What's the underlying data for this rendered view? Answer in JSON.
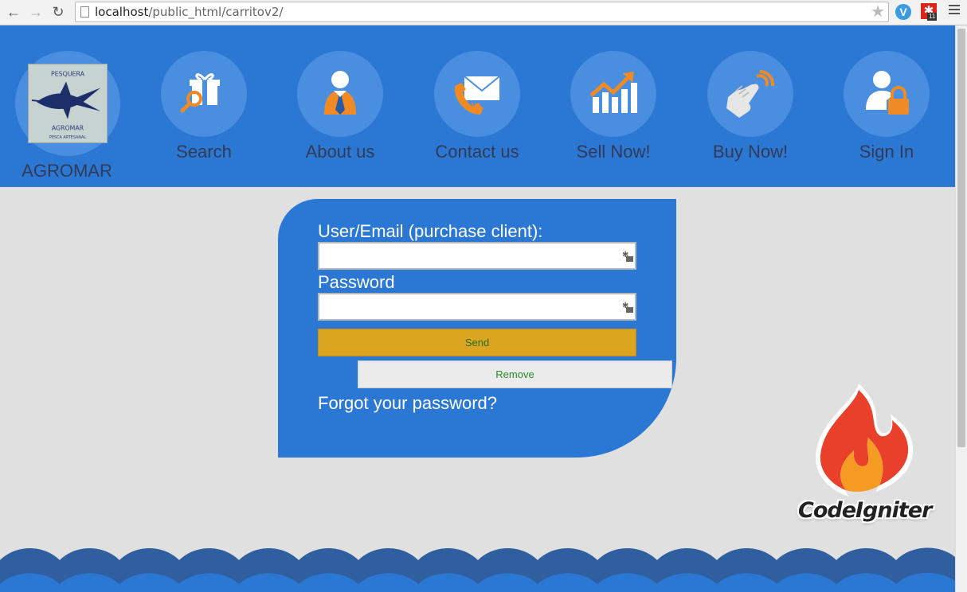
{
  "browser": {
    "url_host": "localhost",
    "url_path": "/public_html/carritov2/",
    "extension_badge": "11"
  },
  "header": {
    "brand": "AGROMAR",
    "nav": [
      {
        "label": "Search",
        "icon": "gift-search-icon"
      },
      {
        "label": "About us",
        "icon": "person-tie-icon"
      },
      {
        "label": "Contact us",
        "icon": "phone-envelope-icon"
      },
      {
        "label": "Sell Now!",
        "icon": "growth-chart-icon"
      },
      {
        "label": "Buy Now!",
        "icon": "pointing-hand-icon"
      },
      {
        "label": "Sign In",
        "icon": "user-lock-icon"
      }
    ]
  },
  "login": {
    "user_label": "User/Email (purchase client):",
    "user_value": "",
    "password_label": "Password",
    "password_value": "",
    "send_label": "Send",
    "remove_label": "Remove",
    "forgot_label": "Forgot your password?"
  },
  "footer": {
    "framework_logo": "CodeIgniter"
  },
  "colors": {
    "header_blue": "#2b78d4",
    "send_gold": "#dba520",
    "icon_orange": "#f08a24",
    "page_gray": "#e0e0e0"
  }
}
